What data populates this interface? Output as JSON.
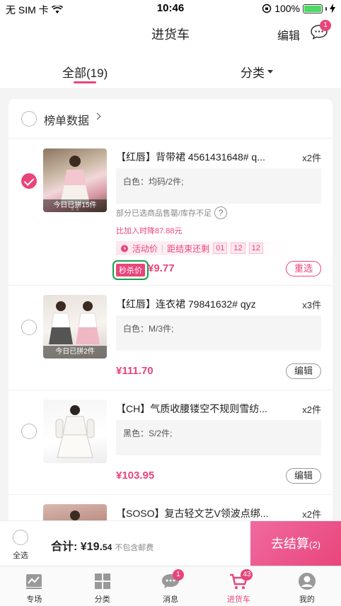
{
  "status_bar": {
    "carrier": "无 SIM 卡",
    "time": "10:46",
    "battery": "100%"
  },
  "navbar": {
    "title": "进货车",
    "edit_label": "编辑",
    "message_badge": "1"
  },
  "tabs": {
    "all_label": "全部(19)",
    "category_label": "分类"
  },
  "rank_row": {
    "label": "榜单数据"
  },
  "items": [
    {
      "name": "【红唇】背带裙  4561431648#  q...",
      "qty": "x2件",
      "spec": "白色：均码/2件;",
      "thumb_caption": "今日已拼15件",
      "stock_note": "部分已选商品售罄/库存不足",
      "price_drop": "比加入时降87.88元",
      "promo_label": "活动价",
      "countdown_label": "距结束还剩",
      "countdown": [
        "01",
        "12",
        "12"
      ],
      "flash_tag": "秒杀价",
      "price": "¥9.77",
      "action": "重选",
      "checked": true
    },
    {
      "name": "【红唇】连衣裙  79841632#  qyz",
      "qty": "x3件",
      "spec": "白色：M/3件;",
      "thumb_caption": "今日已拼2件",
      "price": "¥111.70",
      "action": "编辑",
      "checked": false
    },
    {
      "name": "【CH】气质收腰镂空不规则雪纺...",
      "qty": "x2件",
      "spec": "黑色：S/2件;",
      "price": "¥103.95",
      "action": "编辑",
      "checked": false
    },
    {
      "name": "【SOSO】复古轻文艺V领波点绑...",
      "qty": "x2件",
      "checked": false
    }
  ],
  "checkout": {
    "select_all_label": "全选",
    "total_label": "合计: ",
    "total_int": "¥19.",
    "total_dec": "54",
    "shipping_note": "不包含邮费",
    "checkout_label": "去结算",
    "checkout_count": "(2)"
  },
  "tabbar": [
    {
      "label": "专场",
      "icon": "trend-icon"
    },
    {
      "label": "分类",
      "icon": "grid-icon"
    },
    {
      "label": "消息",
      "icon": "chat-icon",
      "badge": "1"
    },
    {
      "label": "进货车",
      "icon": "cart-icon",
      "badge": "43",
      "active": true
    },
    {
      "label": "我的",
      "icon": "user-icon"
    }
  ],
  "colors": {
    "accent": "#e8457a",
    "highlight_box": "#17a34a"
  }
}
